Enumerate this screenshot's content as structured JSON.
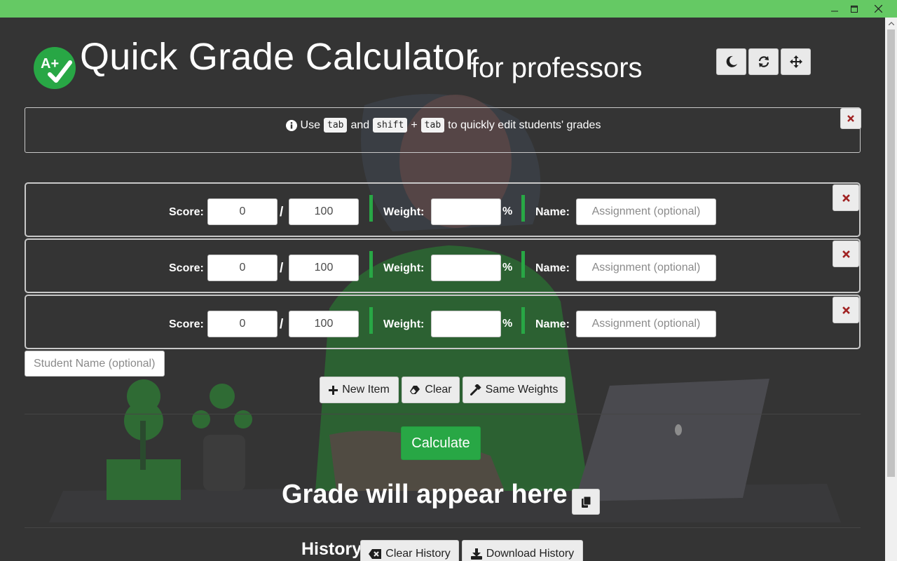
{
  "window": {
    "minimize_icon": "minimize-icon",
    "maximize_icon": "maximize-icon",
    "close_icon": "close-icon",
    "titlebar_color": "#65c964"
  },
  "header": {
    "logo_text": "A+",
    "title": "Quick Grade Calculator",
    "subtitle": "for professors",
    "tools": [
      {
        "name": "dark-mode",
        "icon": "moon-icon"
      },
      {
        "name": "refresh",
        "icon": "refresh-icon"
      },
      {
        "name": "move",
        "icon": "move-icon"
      }
    ]
  },
  "tip": {
    "icon": "info-icon",
    "use": "Use",
    "key_tab": "tab",
    "and": "and",
    "key_shift": "shift",
    "plus": "+",
    "key_tab2": "tab",
    "rest": "to quickly edit students' grades"
  },
  "labels": {
    "score": "Score:",
    "slash": "/",
    "weight": "Weight:",
    "percent": "%",
    "name": "Name:"
  },
  "items": [
    {
      "score": "0",
      "total": "100",
      "weight": "",
      "name_placeholder": "Assignment (optional)"
    },
    {
      "score": "0",
      "total": "100",
      "weight": "",
      "name_placeholder": "Assignment (optional)"
    },
    {
      "score": "0",
      "total": "100",
      "weight": "",
      "name_placeholder": "Assignment (optional)"
    }
  ],
  "student": {
    "placeholder": "Student Name (optional)"
  },
  "actions": {
    "new_item": "New Item",
    "clear": "Clear",
    "same_weights": "Same Weights",
    "calculate": "Calculate"
  },
  "result": {
    "grade_text": "Grade will appear here"
  },
  "history": {
    "title": "History",
    "clear_history": "Clear History",
    "download_history": "Download History"
  },
  "colors": {
    "accent": "#28a745",
    "background": "#343434",
    "close_x": "#a02323"
  }
}
